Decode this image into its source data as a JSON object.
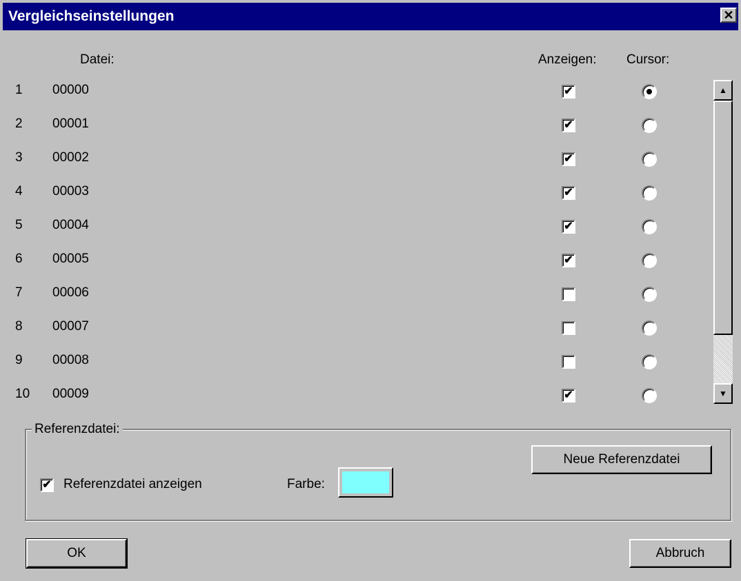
{
  "window": {
    "title": "Vergleichseinstellungen",
    "close_glyph": "✕"
  },
  "headers": {
    "file": "Datei:",
    "show": "Anzeigen:",
    "cursor": "Cursor:"
  },
  "rows": [
    {
      "num": "1",
      "file": "00000",
      "show": true,
      "cursor": true
    },
    {
      "num": "2",
      "file": "00001",
      "show": true,
      "cursor": false
    },
    {
      "num": "3",
      "file": "00002",
      "show": true,
      "cursor": false
    },
    {
      "num": "4",
      "file": "00003",
      "show": true,
      "cursor": false
    },
    {
      "num": "5",
      "file": "00004",
      "show": true,
      "cursor": false
    },
    {
      "num": "6",
      "file": "00005",
      "show": true,
      "cursor": false
    },
    {
      "num": "7",
      "file": "00006",
      "show": false,
      "cursor": false
    },
    {
      "num": "8",
      "file": "00007",
      "show": false,
      "cursor": false
    },
    {
      "num": "9",
      "file": "00008",
      "show": false,
      "cursor": false
    },
    {
      "num": "10",
      "file": "00009",
      "show": true,
      "cursor": false
    }
  ],
  "reference": {
    "legend": "Referenzdatei:",
    "show_label": "Referenzdatei anzeigen",
    "show_checked": true,
    "color_label": "Farbe:",
    "color": "#80ffff",
    "new_button": "Neue Referenzdatei"
  },
  "buttons": {
    "ok": "OK",
    "cancel": "Abbruch"
  },
  "icons": {
    "scroll_up": "▲",
    "scroll_down": "▼",
    "check": "✔"
  }
}
